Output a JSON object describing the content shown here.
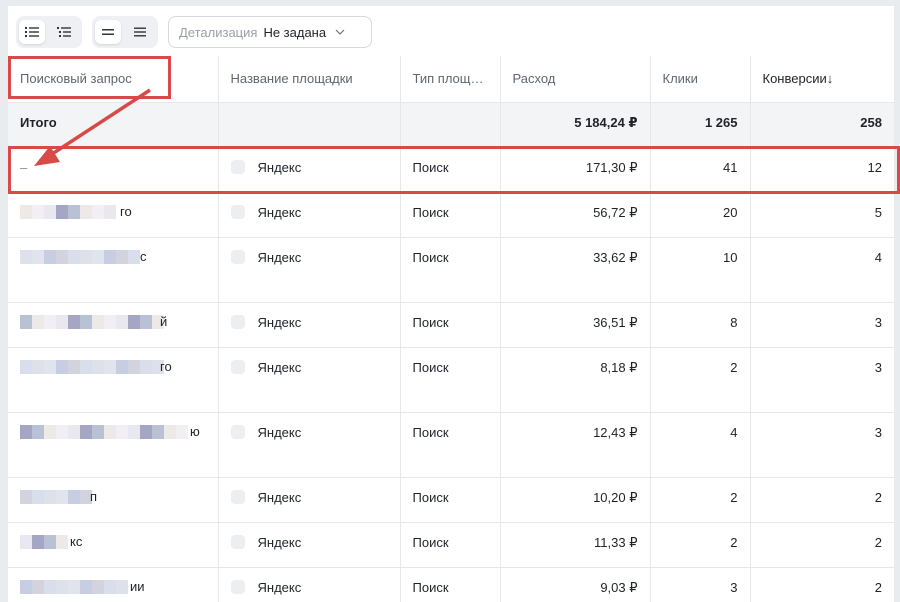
{
  "toolbar": {
    "view_icons": [
      "list-icon",
      "list-nested-icon"
    ],
    "density_icons": [
      "density-compact-icon",
      "density-comfortable-icon"
    ],
    "detail_label": "Детализация",
    "detail_value": "Не задана"
  },
  "table": {
    "columns": [
      "Поисковый запрос",
      "Название площадки",
      "Тип площ…",
      "Расход",
      "Клики",
      "Конверсии↓"
    ],
    "total": {
      "label": "Итого",
      "cost": "5 184,24 ₽",
      "clicks": "1 265",
      "conversions": "258"
    },
    "rows": [
      {
        "query_tail": "–",
        "site": "Яндекс",
        "type": "Поиск",
        "cost": "171,30 ₽",
        "clicks": "41",
        "conversions": "12"
      },
      {
        "query_tail": "го",
        "site": "Яндекс",
        "type": "Поиск",
        "cost": "56,72 ₽",
        "clicks": "20",
        "conversions": "5"
      },
      {
        "query_tail": "с",
        "site": "Яндекс",
        "type": "Поиск",
        "cost": "33,62 ₽",
        "clicks": "10",
        "conversions": "4"
      },
      {
        "query_tail": "й",
        "site": "Яндекс",
        "type": "Поиск",
        "cost": "36,51 ₽",
        "clicks": "8",
        "conversions": "3"
      },
      {
        "query_tail": "го",
        "site": "Яндекс",
        "type": "Поиск",
        "cost": "8,18 ₽",
        "clicks": "2",
        "conversions": "3"
      },
      {
        "query_tail": "ю",
        "site": "Яндекс",
        "type": "Поиск",
        "cost": "12,43 ₽",
        "clicks": "4",
        "conversions": "3"
      },
      {
        "query_tail": "п",
        "site": "Яндекс",
        "type": "Поиск",
        "cost": "10,20 ₽",
        "clicks": "2",
        "conversions": "2"
      },
      {
        "query_tail": "кс",
        "site": "Яндекс",
        "type": "Поиск",
        "cost": "11,33 ₽",
        "clicks": "2",
        "conversions": "2"
      },
      {
        "query_tail": "ии",
        "site": "Яндекс",
        "type": "Поиск",
        "cost": "9,03 ₽",
        "clicks": "3",
        "conversions": "2"
      }
    ]
  },
  "colors": {
    "annotation": "#d64b47",
    "total_row_bg": "#f3f4f6"
  }
}
